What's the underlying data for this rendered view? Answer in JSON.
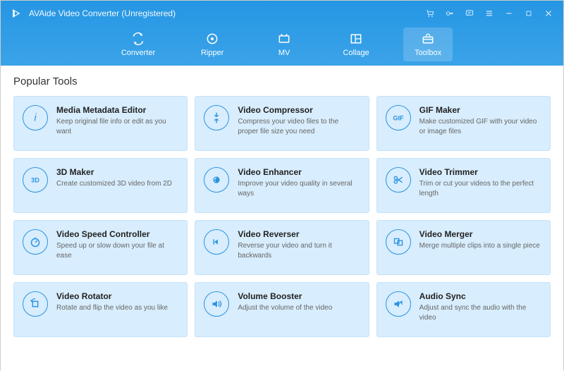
{
  "app": {
    "title": "AVAide Video Converter (Unregistered)"
  },
  "tabs": [
    {
      "label": "Converter",
      "icon": "converter"
    },
    {
      "label": "Ripper",
      "icon": "ripper"
    },
    {
      "label": "MV",
      "icon": "mv"
    },
    {
      "label": "Collage",
      "icon": "collage"
    },
    {
      "label": "Toolbox",
      "icon": "toolbox",
      "active": true
    }
  ],
  "section_title": "Popular Tools",
  "tools": [
    {
      "title": "Media Metadata Editor",
      "desc": "Keep original file info or edit as you want",
      "icon": "info"
    },
    {
      "title": "Video Compressor",
      "desc": "Compress your video files to the proper file size you need",
      "icon": "compress"
    },
    {
      "title": "GIF Maker",
      "desc": "Make customized GIF with your video or image files",
      "icon": "gif"
    },
    {
      "title": "3D Maker",
      "desc": "Create customized 3D video from 2D",
      "icon": "3d"
    },
    {
      "title": "Video Enhancer",
      "desc": "Improve your video quality in several ways",
      "icon": "enhance"
    },
    {
      "title": "Video Trimmer",
      "desc": "Trim or cut your videos to the perfect length",
      "icon": "trim"
    },
    {
      "title": "Video Speed Controller",
      "desc": "Speed up or slow down your file at ease",
      "icon": "speed"
    },
    {
      "title": "Video Reverser",
      "desc": "Reverse your video and turn it backwards",
      "icon": "reverse"
    },
    {
      "title": "Video Merger",
      "desc": "Merge multiple clips into a single piece",
      "icon": "merge"
    },
    {
      "title": "Video Rotator",
      "desc": "Rotate and flip the video as you like",
      "icon": "rotate"
    },
    {
      "title": "Volume Booster",
      "desc": "Adjust the volume of the video",
      "icon": "volume"
    },
    {
      "title": "Audio Sync",
      "desc": "Adjust and sync the audio with the video",
      "icon": "sync"
    }
  ]
}
